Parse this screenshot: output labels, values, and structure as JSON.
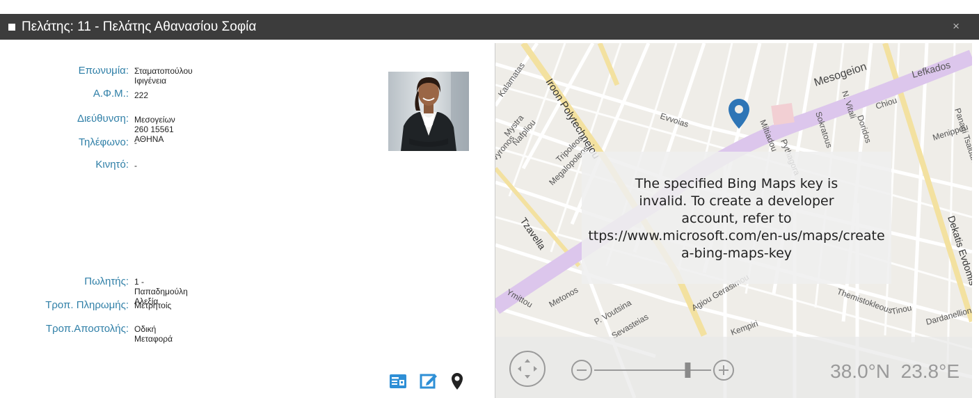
{
  "window": {
    "title": "Πελάτης: 11 - Πελάτης Αθανασίου Σοφία",
    "close_glyph": "×"
  },
  "customer": {
    "fields": [
      {
        "label": "Επωνυμία:",
        "value": "Σταματοπούλου Ιφιγένεια"
      },
      {
        "label": "Α.Φ.Μ.:",
        "value": "222"
      },
      {
        "label": "Διεύθυνση:",
        "value": "Μεσογείων 260  15561 ΑΘΗΝΑ"
      },
      {
        "label": "Τηλέφωνο:",
        "value": "-"
      },
      {
        "label": "Κινητό:",
        "value": "-"
      }
    ],
    "sales_fields": [
      {
        "label": "Πωλητής:",
        "value": "1 - Παπαδημούλη Αλεξία"
      },
      {
        "label": "Τροπ. Πληρωμής:",
        "value": "Μετρητοίς"
      },
      {
        "label": "Τροπ.Αποστολής:",
        "value": "Οδική Μεταφορά"
      }
    ]
  },
  "actions": {
    "icons": [
      "contact-card-icon",
      "edit-icon",
      "map-pin-icon"
    ],
    "accent": "#2e8fd6"
  },
  "map": {
    "error_message": [
      "The specified Bing Maps key is",
      "invalid. To create a developer",
      "account, refer to",
      "ttps://www.microsoft.com/en-us/maps/create",
      "a-bing-maps-key"
    ],
    "latitude": "38.0°N",
    "longitude": "23.8°E",
    "zoom_level_fraction": 0.8,
    "pin_color": "#2e75b6",
    "street_labels": [
      "Mesogeion",
      "Iroon Polytechneiou",
      "Kalamatas",
      "Mystra",
      "Nafpliou",
      "Vyronos",
      "Tripoleos",
      "Megalopoleos",
      "Evvoias",
      "Pythagora",
      "Miltiadou",
      "Sokratous",
      "N. Vitali",
      "Doridos",
      "Chiou",
      "Lefkados",
      "Menippou",
      "Tzavella",
      "Dekatis Evdomis",
      "Ymittou",
      "Metonos",
      "P. Voutsina",
      "Agiou Gerasimou",
      "Themistokleous",
      "Tinou",
      "Dardanellion",
      "Panagi Tsaldari",
      "Kempiri",
      "Sevasteias"
    ]
  }
}
